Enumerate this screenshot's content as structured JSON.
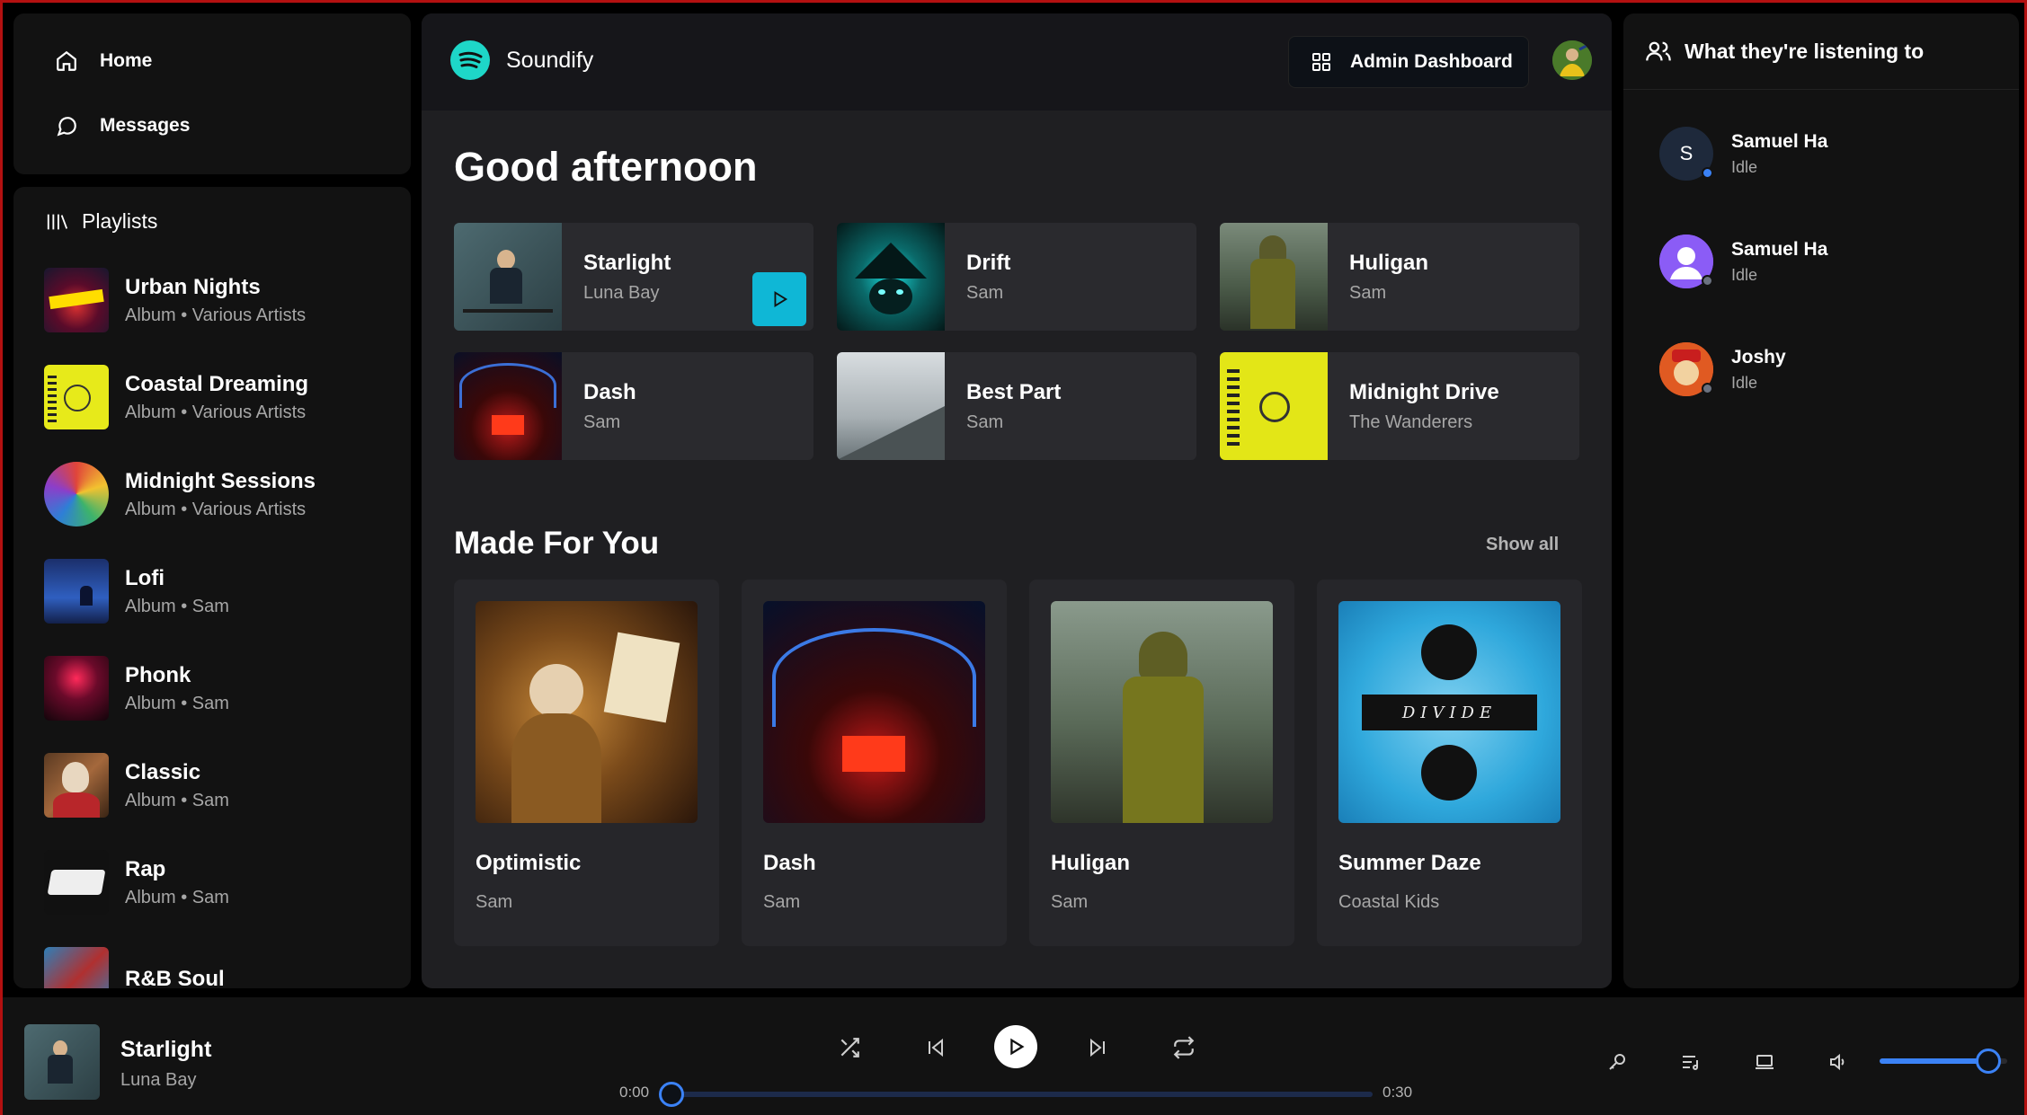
{
  "nav": {
    "home": "Home",
    "messages": "Messages"
  },
  "library": {
    "header": "Playlists",
    "items": [
      {
        "title": "Urban Nights",
        "subtitle": "Album • Various Artists",
        "cover": "urban"
      },
      {
        "title": "Coastal Dreaming",
        "subtitle": "Album • Various Artists",
        "cover": "yellow"
      },
      {
        "title": "Midnight Sessions",
        "subtitle": "Album • Various Artists",
        "cover": "muse"
      },
      {
        "title": "Lofi",
        "subtitle": "Album • Sam",
        "cover": "lofi"
      },
      {
        "title": "Phonk",
        "subtitle": "Album • Sam",
        "cover": "phonk"
      },
      {
        "title": "Classic",
        "subtitle": "Album • Sam",
        "cover": "classic"
      },
      {
        "title": "Rap",
        "subtitle": "Album • Sam",
        "cover": "rap"
      },
      {
        "title": "R&B Soul",
        "subtitle": "",
        "cover": "rnb"
      }
    ]
  },
  "header": {
    "app_name": "Soundify",
    "admin_button": "Admin Dashboard"
  },
  "main": {
    "greeting": "Good afternoon",
    "quick_picks": [
      {
        "title": "Starlight",
        "artist": "Luna Bay"
      },
      {
        "title": "Drift",
        "artist": "Sam"
      },
      {
        "title": "Huligan",
        "artist": "Sam"
      },
      {
        "title": "Dash",
        "artist": "Sam"
      },
      {
        "title": "Best Part",
        "artist": "Sam"
      },
      {
        "title": "Midnight Drive",
        "artist": "The Wanderers"
      }
    ],
    "made_for_you": {
      "title": "Made For You",
      "show_all": "Show all",
      "cards": [
        {
          "title": "Optimistic",
          "artist": "Sam"
        },
        {
          "title": "Dash",
          "artist": "Sam"
        },
        {
          "title": "Huligan",
          "artist": "Sam"
        },
        {
          "title": "Summer Daze",
          "artist": "Coastal Kids"
        }
      ],
      "divide_text": "DIVIDE"
    }
  },
  "friends": {
    "header": "What they're listening to",
    "list": [
      {
        "name": "Samuel Ha",
        "status": "Idle",
        "initial": "S",
        "dot": "#3b82f6"
      },
      {
        "name": "Samuel Ha",
        "status": "Idle",
        "initial": "",
        "dot": "#6b7280"
      },
      {
        "name": "Joshy",
        "status": "Idle",
        "initial": "",
        "dot": "#6b7280"
      }
    ]
  },
  "player": {
    "title": "Starlight",
    "artist": "Luna Bay",
    "current_time": "0:00",
    "duration": "0:30",
    "progress": 0,
    "volume": 0.85
  },
  "colors": {
    "accent": "#0fb7d6",
    "slider": "#3b82f6",
    "brand_logo": "#1ed760"
  }
}
